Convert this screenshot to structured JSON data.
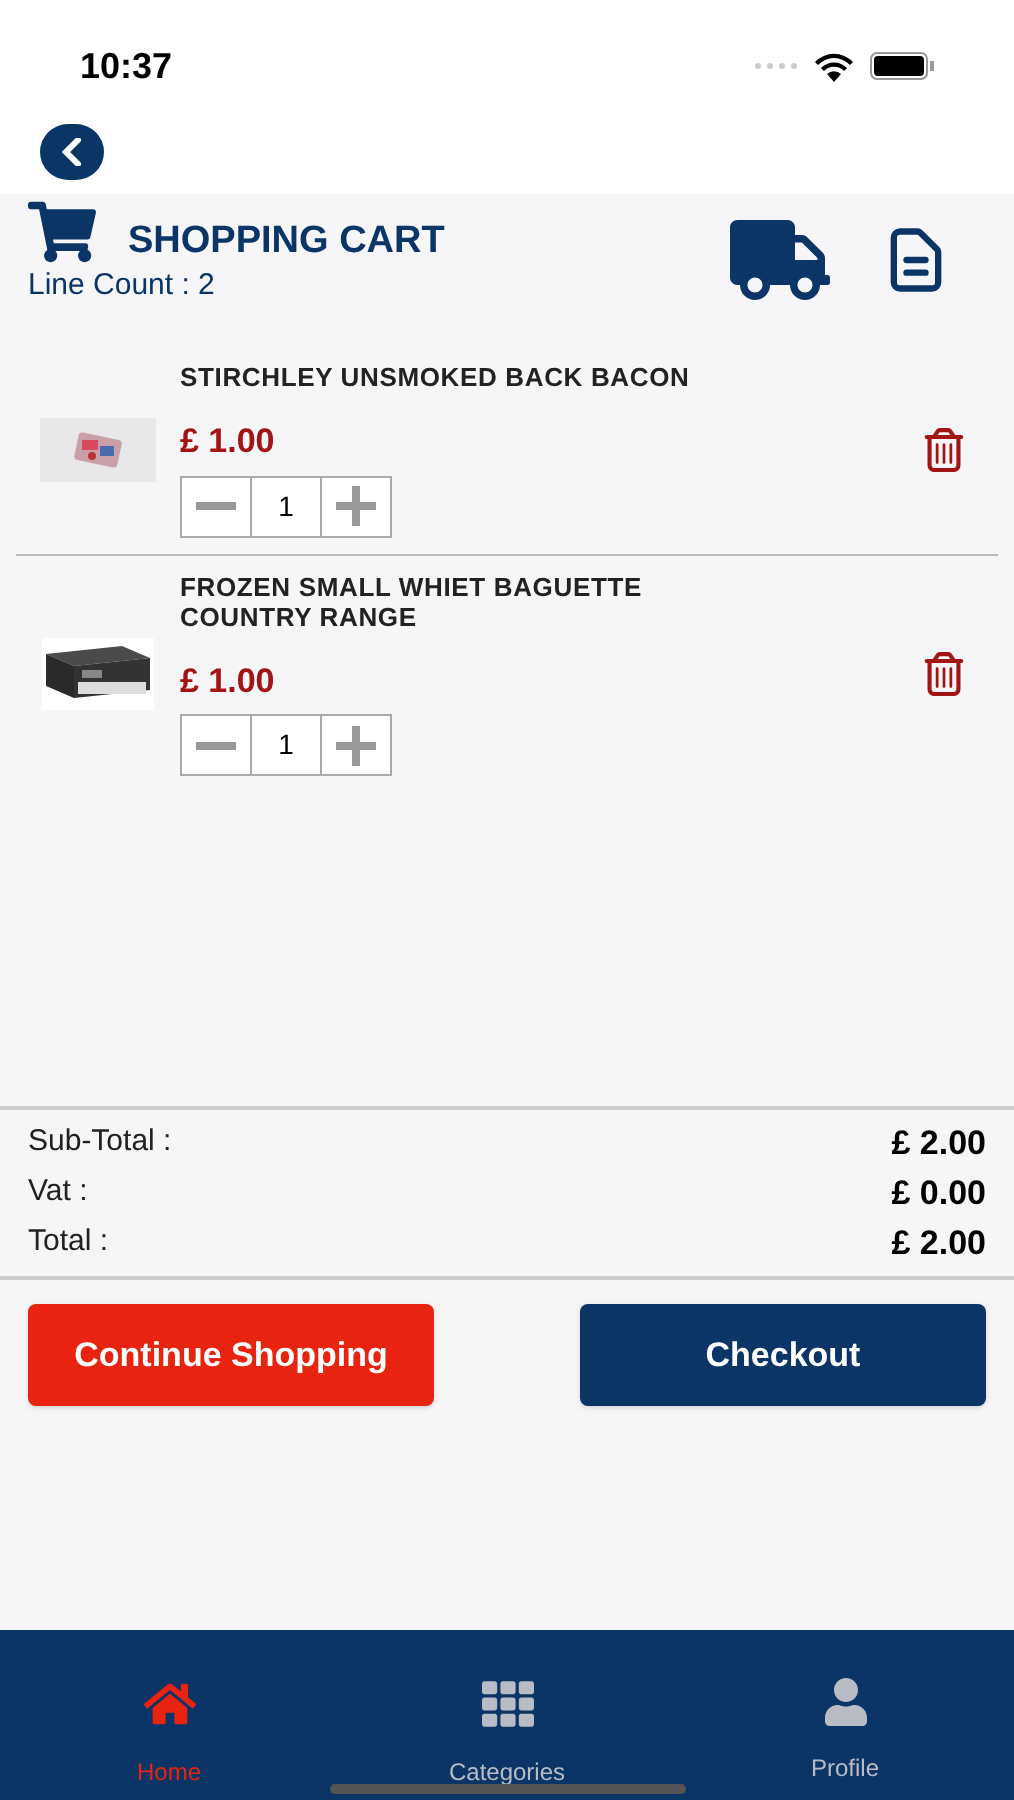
{
  "status_bar": {
    "time": "10:37"
  },
  "header": {
    "title": "SHOPPING CART",
    "line_count": "Line Count : 2"
  },
  "items": [
    {
      "name": "STIRCHLEY UNSMOKED BACK BACON",
      "price": "£ 1.00",
      "quantity": "1"
    },
    {
      "name": "FROZEN SMALL WHIET BAGUETTE COUNTRY RANGE",
      "price": "£ 1.00",
      "quantity": "1"
    }
  ],
  "totals": [
    {
      "label": "Sub-Total :",
      "value": "£ 2.00"
    },
    {
      "label": "Vat :",
      "value": "£ 0.00"
    },
    {
      "label": "Total :",
      "value": "£ 2.00"
    }
  ],
  "buttons": [
    {
      "label": "Continue Shopping",
      "kind": "secondary"
    },
    {
      "label": "Checkout",
      "kind": "primary"
    }
  ],
  "tab_bar": [
    {
      "label": "Home",
      "selected": true
    },
    {
      "label": "Categories",
      "selected": false
    },
    {
      "label": "Profile",
      "selected": false
    }
  ]
}
